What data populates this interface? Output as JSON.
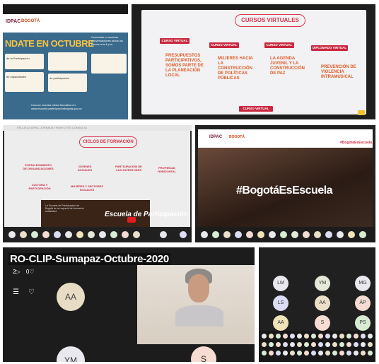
{
  "tile1": {
    "logo": "IDPAC",
    "logo_sub": "BOGOTÁ",
    "headline": "NDATE EN OCTUBRE",
    "right_text": "Conéctate a nuestras conversaciones todos los jueves a la 4 p.m.",
    "labels": [
      "1. ",
      "2. ",
      "3. "
    ],
    "cards": [
      "de la Participación",
      "de capacidades",
      "de participación"
    ],
    "footer": "Conoce nuestra oferta formativa en: www.escuela.participacionbogota.gov.co"
  },
  "tile2": {
    "title": "CURSOS VIRTUALES",
    "pills": [
      "CURSO VIRTUAL",
      "CURSO VIRTUAL",
      "CURSO VIRTUAL",
      "DIPLOMADO VIRTUAL",
      "CURSO VIRTUAL"
    ],
    "courses": [
      "PRESUPUESTOS PARTICIPATIVOS, SOMOS PARTE DE LA PLANEACIÓN LOCAL",
      "MUJERES HACIA LA CONSTRUCCIÓN DE POLÍTICAS PÚBLICAS",
      "LA AGENDA JUVENIL Y LA CONSTRUCCIÓN DE PAZ",
      "PREVENCIÓN DE VIOLENCIA INTRAMUSICAL"
    ]
  },
  "tile3": {
    "nav": "ESCUELA IDPAC   JORNADA   TRAYECTOS   CONSULTA",
    "title": "CICLOS DE FORMACIÓN",
    "cycles": [
      "FORTALECIMIENTO DE ORGANIZACIONES",
      "JÓVENES SOCIALES",
      "PARTICIPACIÓN DE LAS JUVENTUDES",
      "CULTURA Y PARTICIPACIÓN",
      "MUJERES Y SECTORES SOCIALES",
      "PROPIEDAD HORIZONTAL"
    ],
    "video_text": "La Escuela de Participación de Bogotá es un espacio de formación ciudadana",
    "video_title": "Escuela de Participación"
  },
  "tile4": {
    "logo": "IDPAC",
    "logo_sub": "BOGOTÁ",
    "tag": "#BogotáEsEscuela",
    "hashtag": "#BogotáEsEscuela"
  },
  "tile5": {
    "clip_title": "RO-CLIP-Sumapaz-Octubre-2020",
    "plays": "2",
    "likes": "0",
    "avatar1": "AA",
    "avatar2": "YM",
    "avatar3": "S"
  },
  "tile6": {
    "participants": [
      {
        "initials": "LM",
        "color": "#e8e8ee"
      },
      {
        "initials": "YM",
        "color": "#e4e8d8"
      },
      {
        "initials": "MG",
        "color": "#e8e8ee"
      },
      {
        "initials": "LS",
        "color": "#dcdcf4"
      },
      {
        "initials": "AA",
        "color": "#eadfc8"
      },
      {
        "initials": "ÁP",
        "color": "#f4dcd2"
      },
      {
        "initials": "AA",
        "color": "#f0e4b8"
      },
      {
        "initials": "S",
        "color": "#f6dcd2"
      },
      {
        "initials": "PS",
        "color": "#d8ecd4"
      }
    ]
  }
}
